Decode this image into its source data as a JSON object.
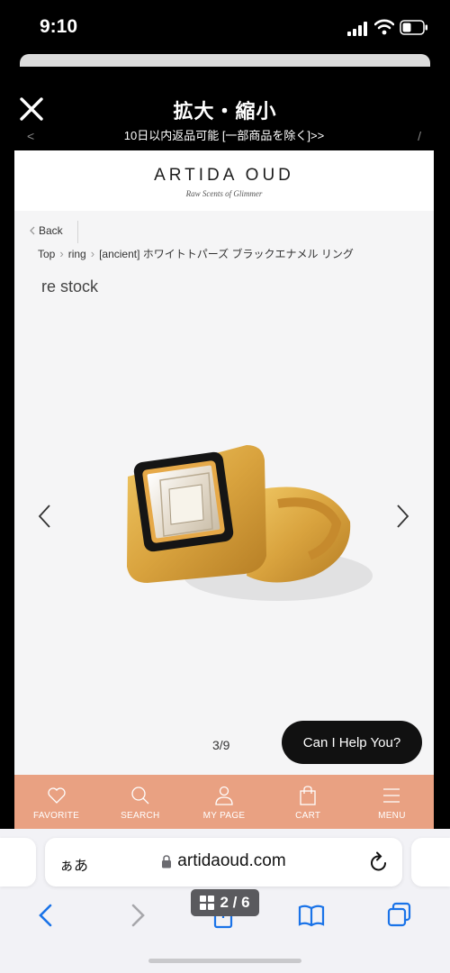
{
  "status_bar": {
    "time": "9:10"
  },
  "viewer": {
    "title": "拡大・縮小"
  },
  "promo": {
    "text": "10日以内返品可能 [一部商品を除く]>>",
    "left_chevron": "<",
    "right_chevron": "/"
  },
  "site": {
    "brand": "ARTIDA OUD",
    "tagline": "Raw Scents of Glimmer",
    "back_label": "Back",
    "breadcrumb": [
      "Top",
      "ring",
      "[ancient] ホワイトトパーズ ブラックエナメル リング"
    ],
    "stock_label": "re stock",
    "image_counter": "3/9",
    "help_button": "Can I Help You?",
    "nav": [
      {
        "label": "FAVORITE",
        "icon": "heart-icon"
      },
      {
        "label": "SEARCH",
        "icon": "search-icon"
      },
      {
        "label": "MY PAGE",
        "icon": "user-icon"
      },
      {
        "label": "CART",
        "icon": "bag-icon"
      },
      {
        "label": "MENU",
        "icon": "menu-icon"
      }
    ]
  },
  "browser": {
    "aa_label": "ぁあ",
    "url": "artidaoud.com",
    "page_indicator": "2 / 6"
  },
  "colors": {
    "nav_bg": "#e9a182",
    "accent_blue": "#1a73e8",
    "help_bg": "#111111"
  }
}
